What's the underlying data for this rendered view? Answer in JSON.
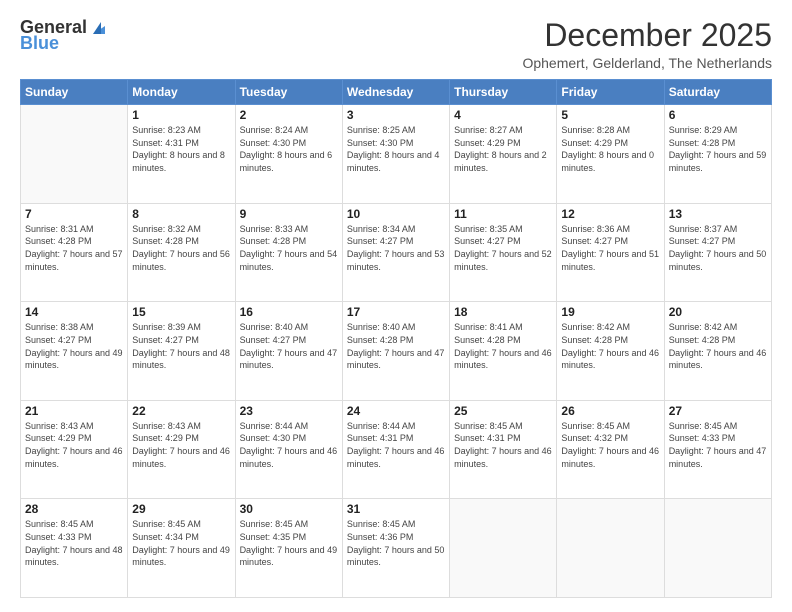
{
  "logo": {
    "general": "General",
    "blue": "Blue"
  },
  "header": {
    "month": "December 2025",
    "location": "Ophemert, Gelderland, The Netherlands"
  },
  "weekdays": [
    "Sunday",
    "Monday",
    "Tuesday",
    "Wednesday",
    "Thursday",
    "Friday",
    "Saturday"
  ],
  "weeks": [
    [
      {
        "day": "",
        "sunrise": "",
        "sunset": "",
        "daylight": ""
      },
      {
        "day": "1",
        "sunrise": "Sunrise: 8:23 AM",
        "sunset": "Sunset: 4:31 PM",
        "daylight": "Daylight: 8 hours and 8 minutes."
      },
      {
        "day": "2",
        "sunrise": "Sunrise: 8:24 AM",
        "sunset": "Sunset: 4:30 PM",
        "daylight": "Daylight: 8 hours and 6 minutes."
      },
      {
        "day": "3",
        "sunrise": "Sunrise: 8:25 AM",
        "sunset": "Sunset: 4:30 PM",
        "daylight": "Daylight: 8 hours and 4 minutes."
      },
      {
        "day": "4",
        "sunrise": "Sunrise: 8:27 AM",
        "sunset": "Sunset: 4:29 PM",
        "daylight": "Daylight: 8 hours and 2 minutes."
      },
      {
        "day": "5",
        "sunrise": "Sunrise: 8:28 AM",
        "sunset": "Sunset: 4:29 PM",
        "daylight": "Daylight: 8 hours and 0 minutes."
      },
      {
        "day": "6",
        "sunrise": "Sunrise: 8:29 AM",
        "sunset": "Sunset: 4:28 PM",
        "daylight": "Daylight: 7 hours and 59 minutes."
      }
    ],
    [
      {
        "day": "7",
        "sunrise": "Sunrise: 8:31 AM",
        "sunset": "Sunset: 4:28 PM",
        "daylight": "Daylight: 7 hours and 57 minutes."
      },
      {
        "day": "8",
        "sunrise": "Sunrise: 8:32 AM",
        "sunset": "Sunset: 4:28 PM",
        "daylight": "Daylight: 7 hours and 56 minutes."
      },
      {
        "day": "9",
        "sunrise": "Sunrise: 8:33 AM",
        "sunset": "Sunset: 4:28 PM",
        "daylight": "Daylight: 7 hours and 54 minutes."
      },
      {
        "day": "10",
        "sunrise": "Sunrise: 8:34 AM",
        "sunset": "Sunset: 4:27 PM",
        "daylight": "Daylight: 7 hours and 53 minutes."
      },
      {
        "day": "11",
        "sunrise": "Sunrise: 8:35 AM",
        "sunset": "Sunset: 4:27 PM",
        "daylight": "Daylight: 7 hours and 52 minutes."
      },
      {
        "day": "12",
        "sunrise": "Sunrise: 8:36 AM",
        "sunset": "Sunset: 4:27 PM",
        "daylight": "Daylight: 7 hours and 51 minutes."
      },
      {
        "day": "13",
        "sunrise": "Sunrise: 8:37 AM",
        "sunset": "Sunset: 4:27 PM",
        "daylight": "Daylight: 7 hours and 50 minutes."
      }
    ],
    [
      {
        "day": "14",
        "sunrise": "Sunrise: 8:38 AM",
        "sunset": "Sunset: 4:27 PM",
        "daylight": "Daylight: 7 hours and 49 minutes."
      },
      {
        "day": "15",
        "sunrise": "Sunrise: 8:39 AM",
        "sunset": "Sunset: 4:27 PM",
        "daylight": "Daylight: 7 hours and 48 minutes."
      },
      {
        "day": "16",
        "sunrise": "Sunrise: 8:40 AM",
        "sunset": "Sunset: 4:27 PM",
        "daylight": "Daylight: 7 hours and 47 minutes."
      },
      {
        "day": "17",
        "sunrise": "Sunrise: 8:40 AM",
        "sunset": "Sunset: 4:28 PM",
        "daylight": "Daylight: 7 hours and 47 minutes."
      },
      {
        "day": "18",
        "sunrise": "Sunrise: 8:41 AM",
        "sunset": "Sunset: 4:28 PM",
        "daylight": "Daylight: 7 hours and 46 minutes."
      },
      {
        "day": "19",
        "sunrise": "Sunrise: 8:42 AM",
        "sunset": "Sunset: 4:28 PM",
        "daylight": "Daylight: 7 hours and 46 minutes."
      },
      {
        "day": "20",
        "sunrise": "Sunrise: 8:42 AM",
        "sunset": "Sunset: 4:28 PM",
        "daylight": "Daylight: 7 hours and 46 minutes."
      }
    ],
    [
      {
        "day": "21",
        "sunrise": "Sunrise: 8:43 AM",
        "sunset": "Sunset: 4:29 PM",
        "daylight": "Daylight: 7 hours and 46 minutes."
      },
      {
        "day": "22",
        "sunrise": "Sunrise: 8:43 AM",
        "sunset": "Sunset: 4:29 PM",
        "daylight": "Daylight: 7 hours and 46 minutes."
      },
      {
        "day": "23",
        "sunrise": "Sunrise: 8:44 AM",
        "sunset": "Sunset: 4:30 PM",
        "daylight": "Daylight: 7 hours and 46 minutes."
      },
      {
        "day": "24",
        "sunrise": "Sunrise: 8:44 AM",
        "sunset": "Sunset: 4:31 PM",
        "daylight": "Daylight: 7 hours and 46 minutes."
      },
      {
        "day": "25",
        "sunrise": "Sunrise: 8:45 AM",
        "sunset": "Sunset: 4:31 PM",
        "daylight": "Daylight: 7 hours and 46 minutes."
      },
      {
        "day": "26",
        "sunrise": "Sunrise: 8:45 AM",
        "sunset": "Sunset: 4:32 PM",
        "daylight": "Daylight: 7 hours and 46 minutes."
      },
      {
        "day": "27",
        "sunrise": "Sunrise: 8:45 AM",
        "sunset": "Sunset: 4:33 PM",
        "daylight": "Daylight: 7 hours and 47 minutes."
      }
    ],
    [
      {
        "day": "28",
        "sunrise": "Sunrise: 8:45 AM",
        "sunset": "Sunset: 4:33 PM",
        "daylight": "Daylight: 7 hours and 48 minutes."
      },
      {
        "day": "29",
        "sunrise": "Sunrise: 8:45 AM",
        "sunset": "Sunset: 4:34 PM",
        "daylight": "Daylight: 7 hours and 49 minutes."
      },
      {
        "day": "30",
        "sunrise": "Sunrise: 8:45 AM",
        "sunset": "Sunset: 4:35 PM",
        "daylight": "Daylight: 7 hours and 49 minutes."
      },
      {
        "day": "31",
        "sunrise": "Sunrise: 8:45 AM",
        "sunset": "Sunset: 4:36 PM",
        "daylight": "Daylight: 7 hours and 50 minutes."
      },
      {
        "day": "",
        "sunrise": "",
        "sunset": "",
        "daylight": ""
      },
      {
        "day": "",
        "sunrise": "",
        "sunset": "",
        "daylight": ""
      },
      {
        "day": "",
        "sunrise": "",
        "sunset": "",
        "daylight": ""
      }
    ]
  ]
}
